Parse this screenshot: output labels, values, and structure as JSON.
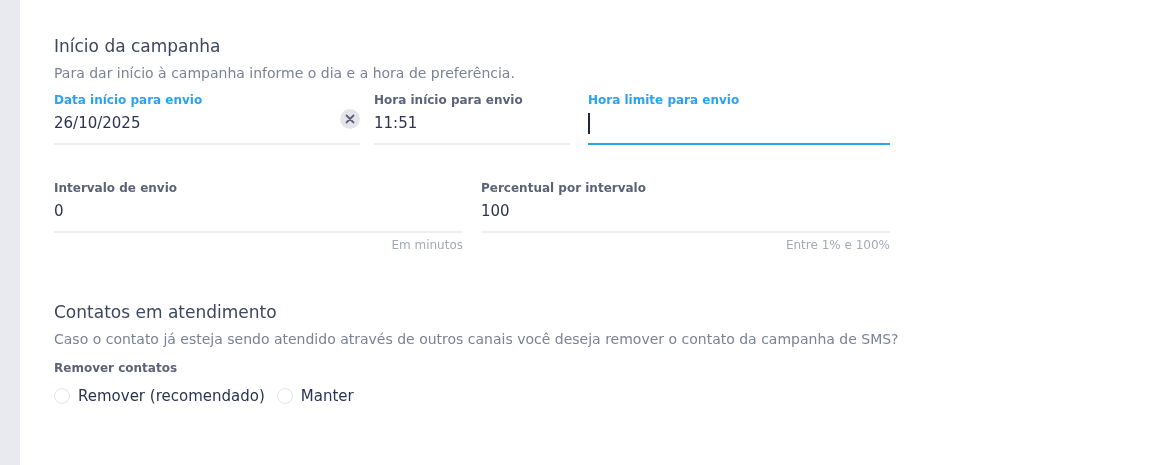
{
  "sections": [
    {
      "title": "Início da campanha",
      "description": "Para dar início à campanha informe o dia e a hora de preferência.",
      "field_rows": [
        {
          "fields": [
            {
              "label": "Data início para envio",
              "value": "26/10/2025",
              "label_active": true,
              "focused": false,
              "clearable": true
            },
            {
              "label": "Hora início para envio",
              "value": "11:51",
              "label_active": false,
              "focused": false,
              "clearable": false
            },
            {
              "label": "Hora limite para envio",
              "label_active": true,
              "focused": true,
              "clearable": false
            }
          ]
        },
        {
          "fields": [
            {
              "label": "Intervalo de envio",
              "value": "0",
              "hint": "Em minutos",
              "label_active": false,
              "focused": false,
              "clearable": false
            },
            {
              "label": "Percentual por intervalo",
              "value": "100",
              "hint": "Entre 1% e 100%",
              "label_active": false,
              "focused": false,
              "clearable": false
            }
          ]
        }
      ]
    },
    {
      "title": "Contatos em atendimento",
      "description": "Caso o contato já esteja sendo atendido através de outros canais você deseja remover o contato da campanha de SMS?",
      "radio_group": {
        "label": "Remover contatos",
        "options": [
          {
            "label": "Remover (recomendado)",
            "selected": false
          },
          {
            "label": "Manter",
            "selected": false
          }
        ]
      }
    }
  ]
}
